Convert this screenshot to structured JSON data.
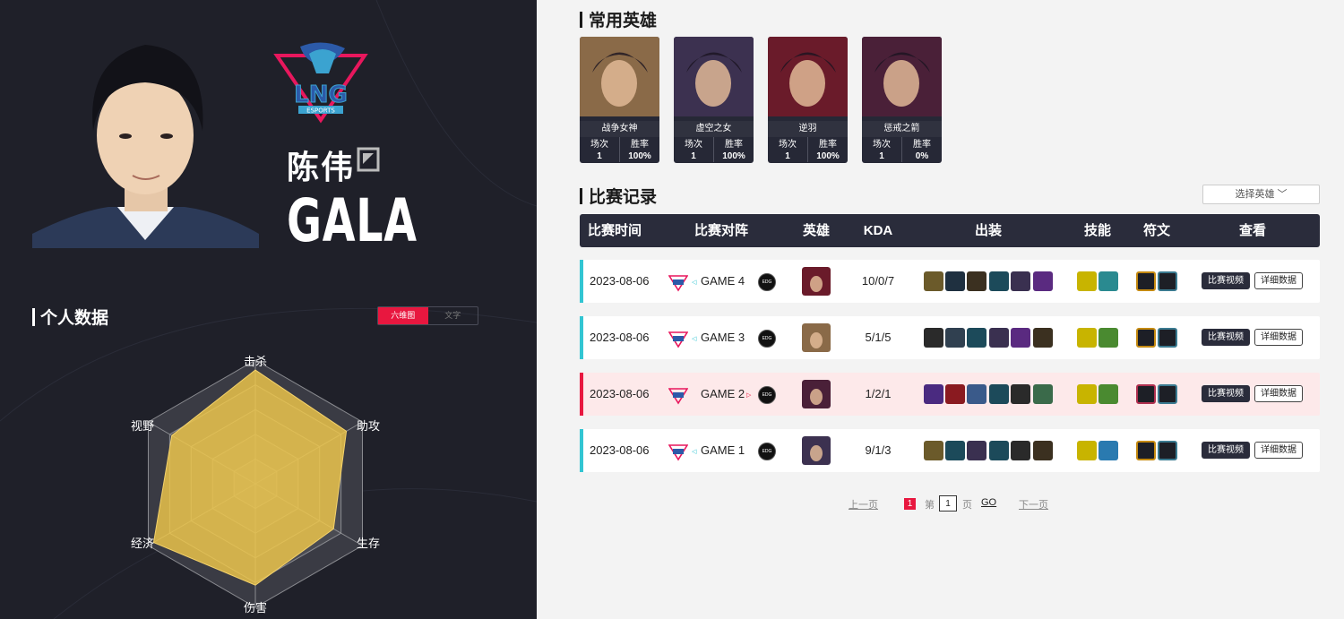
{
  "player": {
    "name_cn": "陈伟",
    "id": "GALA",
    "team": "LNG",
    "team_logo_text": "ESPORTS"
  },
  "stats_panel": {
    "title": "个人数据",
    "toggle": [
      "六维图",
      "文字"
    ],
    "axes": [
      "击杀",
      "助攻",
      "生存",
      "伤害",
      "经济",
      "视野"
    ],
    "values": [
      0.92,
      0.85,
      0.73,
      0.82,
      0.95,
      0.78
    ]
  },
  "heroes_section": {
    "title": "常用英雄",
    "matches_label": "场次",
    "winrate_label": "胜率"
  },
  "heroes": [
    {
      "name": "战争女神",
      "matches": "1",
      "winrate": "100%",
      "color": "#8a6a48"
    },
    {
      "name": "虚空之女",
      "matches": "1",
      "winrate": "100%",
      "color": "#3c3150"
    },
    {
      "name": "逆羽",
      "matches": "1",
      "winrate": "100%",
      "color": "#6a1b2a"
    },
    {
      "name": "惩戒之箭",
      "matches": "1",
      "winrate": "0%",
      "color": "#4a2038"
    }
  ],
  "records": {
    "title": "比赛记录",
    "select_label": "选择英雄",
    "columns": [
      "比赛时间",
      "比赛对阵",
      "英雄",
      "KDA",
      "出装",
      "技能",
      "符文",
      "查看"
    ],
    "video_label": "比赛视频",
    "detail_label": "详细数据",
    "opponent": "EDG",
    "rows": [
      {
        "date": "2023-08-06",
        "game": "GAME 4",
        "result": "win",
        "hero_color": "#6a1b2a",
        "kda": "10/0/7",
        "items": [
          "#6b5a2a",
          "#1f3040",
          "#3b3020",
          "#1c4a5a",
          "#3a3050",
          "#5a2a80"
        ],
        "spells": [
          "#c8b400",
          "#2a8a90"
        ],
        "runes": [
          "#c58a10",
          "#3a7a90"
        ]
      },
      {
        "date": "2023-08-06",
        "game": "GAME 3",
        "result": "win",
        "hero_color": "#8a6a48",
        "kda": "5/1/5",
        "items": [
          "#2a2a2a",
          "#304050",
          "#1c4a5a",
          "#3a3050",
          "#5a2a80",
          "#3b3020"
        ],
        "spells": [
          "#c8b400",
          "#4a8a30"
        ],
        "runes": [
          "#c58a10",
          "#3a7a90"
        ]
      },
      {
        "date": "2023-08-06",
        "game": "GAME 2",
        "result": "loss",
        "hero_color": "#4a2038",
        "kda": "1/2/1",
        "items": [
          "#4a2a80",
          "#8a1a20",
          "#3a5a8a",
          "#1c4a5a",
          "#2a2a2a",
          "#3a6a4a"
        ],
        "spells": [
          "#c8b400",
          "#4a8a30"
        ],
        "runes": [
          "#b03050",
          "#3a7a90"
        ]
      },
      {
        "date": "2023-08-06",
        "game": "GAME 1",
        "result": "win",
        "hero_color": "#3c3150",
        "kda": "9/1/3",
        "items": [
          "#6b5a2a",
          "#1c4a5a",
          "#3a3050",
          "#1c4a5a",
          "#2a2a2a",
          "#3b3020"
        ],
        "spells": [
          "#c8b400",
          "#2a7ab0"
        ],
        "runes": [
          "#c58a10",
          "#3a7a90"
        ]
      }
    ]
  },
  "pager": {
    "prev": "上一页",
    "current": "1",
    "page_prefix": "第",
    "page_value": "1",
    "page_suffix": "页",
    "go": "GO",
    "next": "下一页"
  }
}
